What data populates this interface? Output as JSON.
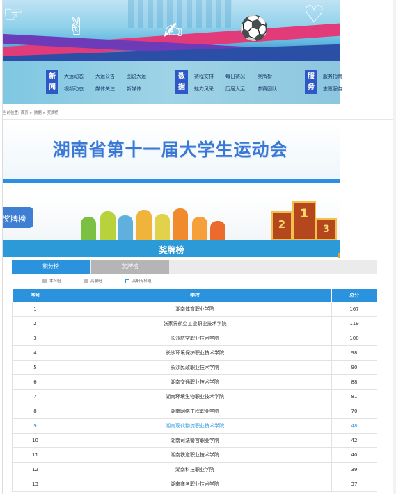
{
  "nav": {
    "groups": [
      {
        "badge": "新闻",
        "links": [
          "大运动态",
          "大运公告",
          "图说大运",
          "视频动态",
          "媒体关注",
          "新媒体"
        ]
      },
      {
        "badge": "数据",
        "links": [
          "赛程安排",
          "每日赛况",
          "奖牌榜",
          "魅力风采",
          "历届大运",
          "参赛团队"
        ]
      },
      {
        "badge": "服务",
        "links": [
          "服务指南",
          "志愿服务"
        ]
      }
    ]
  },
  "breadcrumb": "当前位置: 首页 > 数据 > 奖牌榜",
  "page_title": "湖南省第十一届大学生运动会",
  "medal_tag": "奖牌榜",
  "podium": [
    "2",
    "1",
    "3"
  ],
  "section_title": "奖牌榜",
  "tabs": [
    {
      "label": "积分榜",
      "active": true
    },
    {
      "label": "奖牌榜",
      "active": false
    }
  ],
  "legend": [
    {
      "label": "本科组",
      "color": "#bdbdbd"
    },
    {
      "label": "高职组",
      "color": "#bdbdbd"
    },
    {
      "label": "高职专科组",
      "color": "#ffffff"
    }
  ],
  "table": {
    "headers": [
      "序号",
      "学校",
      "总分"
    ],
    "rows": [
      {
        "rank": "1",
        "school": "湖南体育职业学院",
        "score": "167"
      },
      {
        "rank": "2",
        "school": "张家界航空工业职业技术学院",
        "score": "119"
      },
      {
        "rank": "3",
        "school": "长沙航空职业技术学院",
        "score": "100"
      },
      {
        "rank": "4",
        "school": "长沙环境保护职业技术学院",
        "score": "98"
      },
      {
        "rank": "5",
        "school": "长沙民政职业技术学院",
        "score": "90"
      },
      {
        "rank": "6",
        "school": "湖南交通职业技术学院",
        "score": "88"
      },
      {
        "rank": "7",
        "school": "湖南环境生物职业技术学院",
        "score": "81"
      },
      {
        "rank": "8",
        "school": "湖南网络工程职业学院",
        "score": "70"
      },
      {
        "rank": "9",
        "school": "湖南现代物流职业技术学院",
        "score": "48",
        "highlight": true
      },
      {
        "rank": "10",
        "school": "湖南司法警官职业学院",
        "score": "42"
      },
      {
        "rank": "11",
        "school": "湖南铁道职业技术学院",
        "score": "40"
      },
      {
        "rank": "12",
        "school": "湖南科技职业学院",
        "score": "39"
      },
      {
        "rank": "13",
        "school": "湖南商务职业技术学院",
        "score": "37"
      }
    ]
  },
  "colors": {
    "accent": "#2b92dd",
    "title": "#3a78d6",
    "highlight_row": "#2d98e0"
  }
}
